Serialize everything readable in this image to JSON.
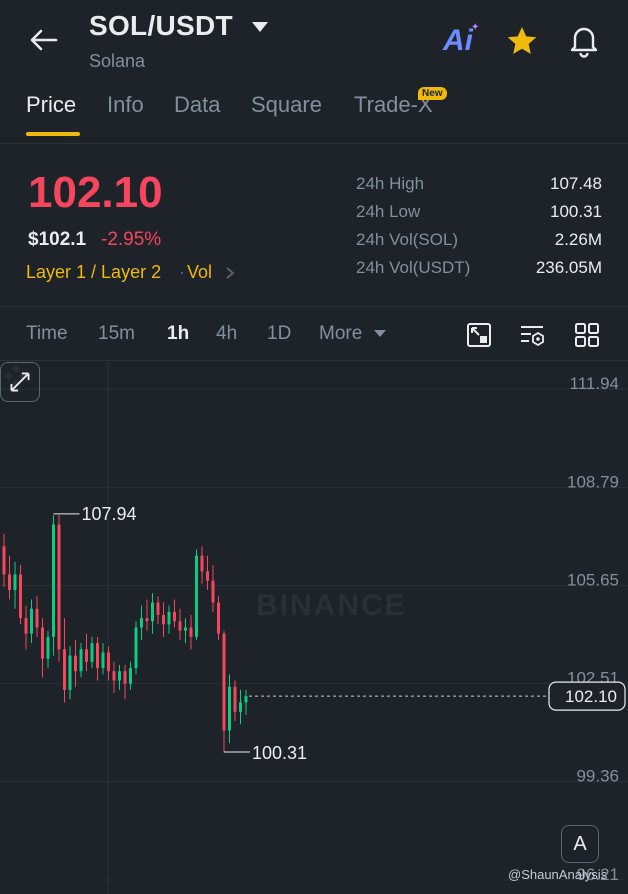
{
  "header": {
    "pair": "SOL/USDT",
    "name": "Solana",
    "ai_label": "Ai",
    "icons": [
      "back-arrow-icon",
      "dropdown-caret-icon",
      "ai-icon",
      "star-icon",
      "bell-icon"
    ]
  },
  "tabs": [
    {
      "label": "Price",
      "active": true
    },
    {
      "label": "Info"
    },
    {
      "label": "Data"
    },
    {
      "label": "Square"
    },
    {
      "label": "Trade-X",
      "badge": "New"
    }
  ],
  "price": {
    "last": "102.10",
    "fiat": "$102.1",
    "change": "-2.95%",
    "tags": "Layer 1 / Layer 2",
    "tag_vol": "Vol"
  },
  "stats": [
    {
      "label": "24h High",
      "value": "107.48"
    },
    {
      "label": "24h Low",
      "value": "100.31"
    },
    {
      "label": "24h Vol(SOL)",
      "value": "2.26M"
    },
    {
      "label": "24h Vol(USDT)",
      "value": "236.05M"
    }
  ],
  "intervals": [
    {
      "label": "Time"
    },
    {
      "label": "15m"
    },
    {
      "label": "1h",
      "active": true
    },
    {
      "label": "4h"
    },
    {
      "label": "1D"
    },
    {
      "label": "More"
    }
  ],
  "toolbar_icons": [
    "indicator-settings-icon",
    "chart-settings-icon",
    "layout-grid-icon"
  ],
  "chart": {
    "watermark": "BINANCE",
    "y_ticks": [
      "111.94",
      "108.79",
      "105.65",
      "102.51",
      "99.36",
      "96.21"
    ],
    "high_label": "107.94",
    "low_label": "100.31",
    "current_label": "102.10",
    "a_button": "A",
    "credit": "@ShaunAnalysis"
  },
  "colors": {
    "up": "#0ecb81",
    "down": "#f6465d",
    "accent": "#f0b90b",
    "background": "#1e2329"
  },
  "chart_data": {
    "type": "candlestick",
    "ylim": [
      96.21,
      111.94
    ],
    "y_ticks": [
      111.94,
      108.79,
      105.65,
      102.51,
      99.36,
      96.21
    ],
    "highest": 107.94,
    "lowest": 100.31,
    "last_price": 102.1,
    "ohlc": [
      [
        106.9,
        107.3,
        105.6,
        106.0
      ],
      [
        106.0,
        106.6,
        105.2,
        105.5
      ],
      [
        105.5,
        106.4,
        104.9,
        106.0
      ],
      [
        106.0,
        106.3,
        104.4,
        104.6
      ],
      [
        104.6,
        105.0,
        103.6,
        104.1
      ],
      [
        104.1,
        105.2,
        103.8,
        104.9
      ],
      [
        104.9,
        105.3,
        104.0,
        104.3
      ],
      [
        104.3,
        104.6,
        102.7,
        103.3
      ],
      [
        103.3,
        104.2,
        103.0,
        104.0
      ],
      [
        104.0,
        107.9,
        103.4,
        107.6
      ],
      [
        107.6,
        107.9,
        103.2,
        103.6
      ],
      [
        103.6,
        104.6,
        101.9,
        102.3
      ],
      [
        102.3,
        103.7,
        102.0,
        103.4
      ],
      [
        103.4,
        103.9,
        102.4,
        102.9
      ],
      [
        102.9,
        103.8,
        102.7,
        103.6
      ],
      [
        103.6,
        104.1,
        102.9,
        103.2
      ],
      [
        103.2,
        104.0,
        103.0,
        103.8
      ],
      [
        103.8,
        104.0,
        102.6,
        103.0
      ],
      [
        103.0,
        103.8,
        102.8,
        103.5
      ],
      [
        103.5,
        103.7,
        102.6,
        102.9
      ],
      [
        102.9,
        103.2,
        102.2,
        102.6
      ],
      [
        102.6,
        103.1,
        102.3,
        102.9
      ],
      [
        102.9,
        103.1,
        102.0,
        102.5
      ],
      [
        102.5,
        103.2,
        102.3,
        103.0
      ],
      [
        103.0,
        104.5,
        102.8,
        104.3
      ],
      [
        104.3,
        105.0,
        103.9,
        104.6
      ],
      [
        104.6,
        105.2,
        104.2,
        104.5
      ],
      [
        104.5,
        105.4,
        104.1,
        105.1
      ],
      [
        105.1,
        105.3,
        104.4,
        104.7
      ],
      [
        104.7,
        105.1,
        104.0,
        104.4
      ],
      [
        104.4,
        105.0,
        104.1,
        104.8
      ],
      [
        104.8,
        105.2,
        104.3,
        104.5
      ],
      [
        104.5,
        104.9,
        103.9,
        104.2
      ],
      [
        104.2,
        104.6,
        103.8,
        104.3
      ],
      [
        104.3,
        104.7,
        103.6,
        104.0
      ],
      [
        104.0,
        106.8,
        103.9,
        106.6
      ],
      [
        106.6,
        106.9,
        105.7,
        106.1
      ],
      [
        106.1,
        106.6,
        105.5,
        105.8
      ],
      [
        105.8,
        106.3,
        104.8,
        105.1
      ],
      [
        105.1,
        105.3,
        103.9,
        104.1
      ],
      [
        104.1,
        104.2,
        100.3,
        101.0
      ],
      [
        101.0,
        102.8,
        100.6,
        102.4
      ],
      [
        102.4,
        102.6,
        101.3,
        101.6
      ],
      [
        101.6,
        102.3,
        101.2,
        101.9
      ],
      [
        101.9,
        102.3,
        101.5,
        102.1
      ]
    ]
  }
}
